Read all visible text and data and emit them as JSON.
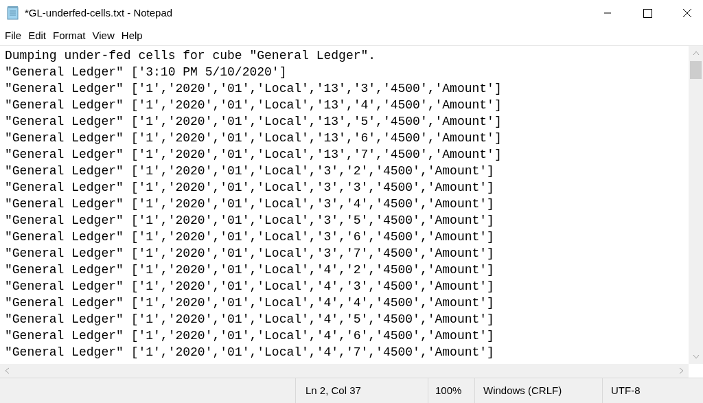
{
  "window": {
    "title": "*GL-underfed-cells.txt - Notepad"
  },
  "menu": [
    "File",
    "Edit",
    "Format",
    "View",
    "Help"
  ],
  "lines": [
    "Dumping under-fed cells for cube \"General Ledger\".",
    "\"General Ledger\" ['3:10 PM 5/10/2020']",
    "\"General Ledger\" ['1','2020','01','Local','13','3','4500','Amount']",
    "\"General Ledger\" ['1','2020','01','Local','13','4','4500','Amount']",
    "\"General Ledger\" ['1','2020','01','Local','13','5','4500','Amount']",
    "\"General Ledger\" ['1','2020','01','Local','13','6','4500','Amount']",
    "\"General Ledger\" ['1','2020','01','Local','13','7','4500','Amount']",
    "\"General Ledger\" ['1','2020','01','Local','3','2','4500','Amount']",
    "\"General Ledger\" ['1','2020','01','Local','3','3','4500','Amount']",
    "\"General Ledger\" ['1','2020','01','Local','3','4','4500','Amount']",
    "\"General Ledger\" ['1','2020','01','Local','3','5','4500','Amount']",
    "\"General Ledger\" ['1','2020','01','Local','3','6','4500','Amount']",
    "\"General Ledger\" ['1','2020','01','Local','3','7','4500','Amount']",
    "\"General Ledger\" ['1','2020','01','Local','4','2','4500','Amount']",
    "\"General Ledger\" ['1','2020','01','Local','4','3','4500','Amount']",
    "\"General Ledger\" ['1','2020','01','Local','4','4','4500','Amount']",
    "\"General Ledger\" ['1','2020','01','Local','4','5','4500','Amount']",
    "\"General Ledger\" ['1','2020','01','Local','4','6','4500','Amount']",
    "\"General Ledger\" ['1','2020','01','Local','4','7','4500','Amount']"
  ],
  "status_bar": {
    "position": "Ln 2, Col 37",
    "zoom": "100%",
    "line_endings": "Windows (CRLF)",
    "encoding": "UTF-8"
  }
}
